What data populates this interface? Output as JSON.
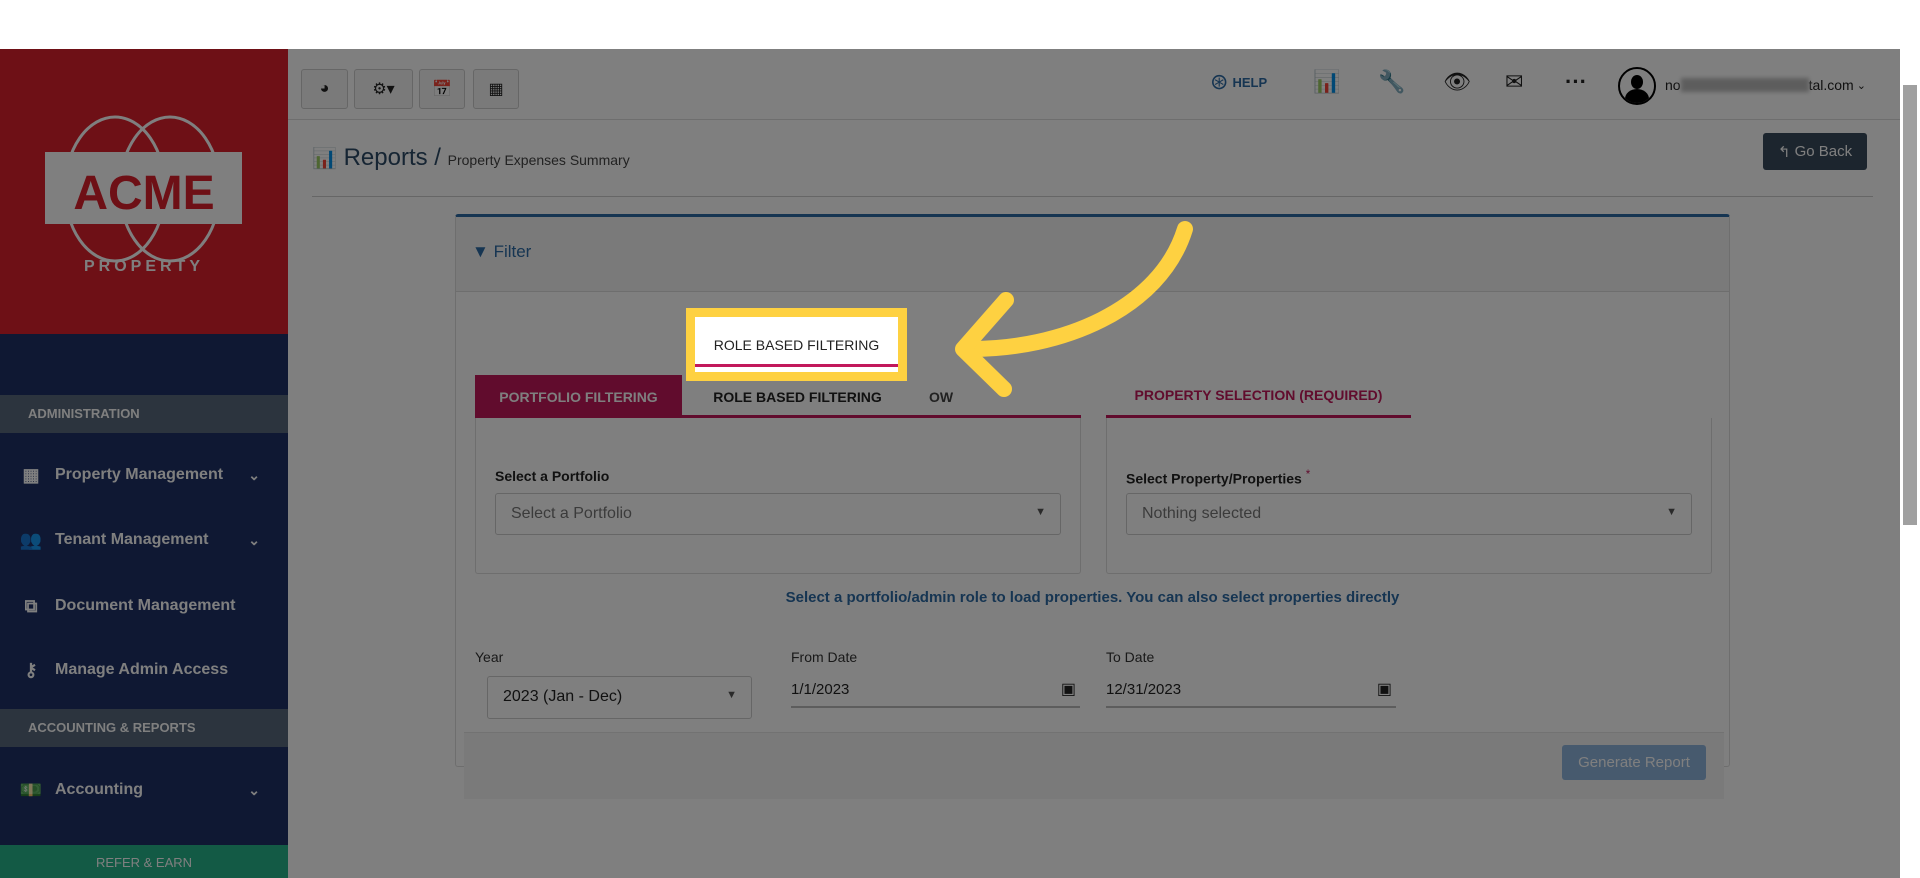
{
  "brand": {
    "logo_text": "ACME",
    "logo_sub": "PROPERTY"
  },
  "sidebar": {
    "sections": [
      {
        "title": "ADMINISTRATION",
        "items": [
          {
            "label": "Property Management",
            "icon": "building-icon",
            "expandable": true
          },
          {
            "label": "Tenant Management",
            "icon": "users-icon",
            "expandable": true
          },
          {
            "label": "Document Management",
            "icon": "documents-icon",
            "expandable": false
          },
          {
            "label": "Manage Admin Access",
            "icon": "key-icon",
            "expandable": false
          }
        ]
      },
      {
        "title": "ACCOUNTING & REPORTS",
        "items": [
          {
            "label": "Accounting",
            "icon": "money-icon",
            "expandable": true
          }
        ]
      }
    ],
    "refer_label": "REFER & EARN"
  },
  "topbar": {
    "help_label": "HELP",
    "email_start": "no",
    "email_end": "tal.com"
  },
  "header": {
    "title": "Reports",
    "separator": "/",
    "subtitle": "Property Expenses Summary",
    "go_back": "Go Back"
  },
  "filter": {
    "title": "Filter",
    "tabs": [
      "PORTFOLIO FILTERING",
      "ROLE BASED FILTERING",
      "OW"
    ],
    "property_tab": "PROPERTY SELECTION (REQUIRED)",
    "portfolio_label": "Select a Portfolio",
    "portfolio_placeholder": "Select a Portfolio",
    "property_label": "Select Property/Properties",
    "required_mark": "*",
    "property_placeholder": "Nothing selected",
    "info": "Select a portfolio/admin role to load properties. You can also select properties directly",
    "year_label": "Year",
    "year_value": "2023 (Jan - Dec)",
    "from_label": "From Date",
    "from_value": "1/1/2023",
    "to_label": "To Date",
    "to_value": "12/31/2023",
    "generate": "Generate Report"
  },
  "colors": {
    "brand_red": "#dc202c",
    "nav": "#1e3066",
    "accent": "#c2185b",
    "highlight": "#fed141",
    "primary": "#2c6aa5"
  }
}
